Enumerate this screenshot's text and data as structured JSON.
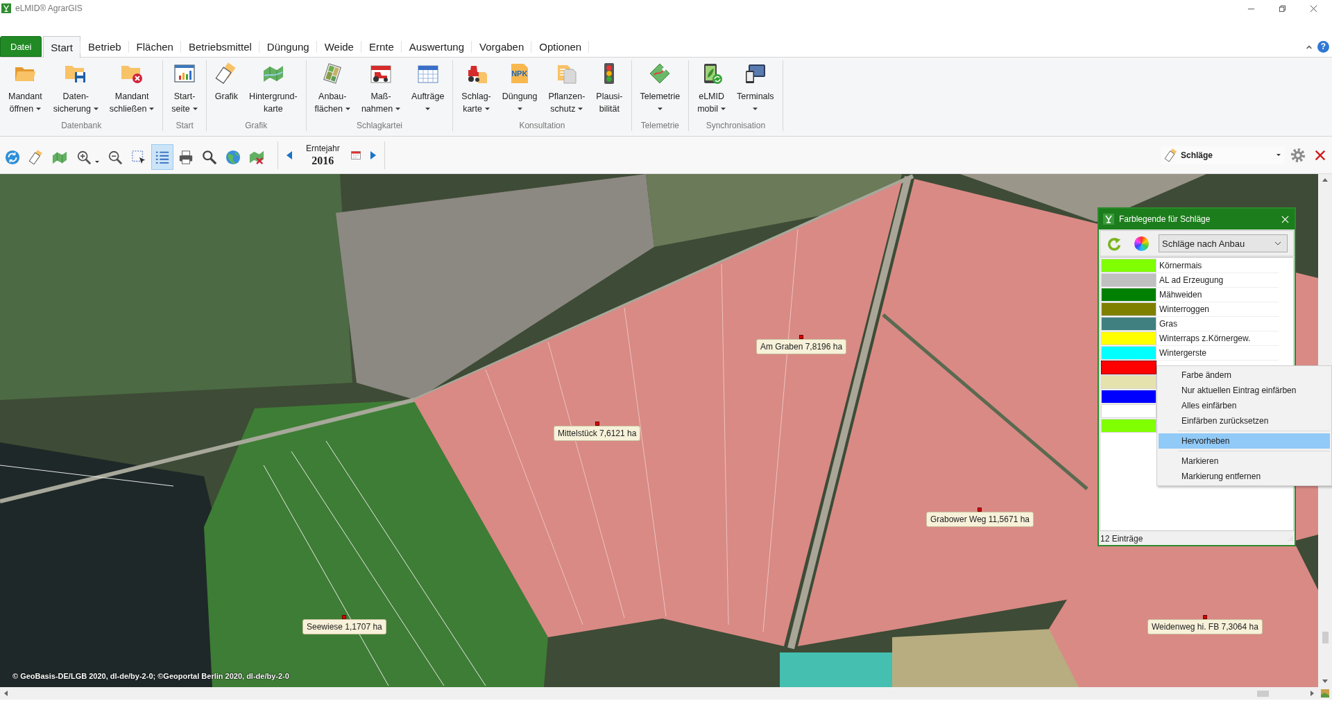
{
  "window": {
    "title": "eLMID® AgrarGIS"
  },
  "tabs": [
    {
      "label": "Datei",
      "kind": "file",
      "selected": false
    },
    {
      "label": "Start",
      "kind": "tab",
      "selected": true
    },
    {
      "label": "Betrieb",
      "kind": "tab",
      "selected": false
    },
    {
      "label": "Flächen",
      "kind": "tab",
      "selected": false
    },
    {
      "label": "Betriebsmittel",
      "kind": "tab",
      "selected": false
    },
    {
      "label": "Düngung",
      "kind": "tab",
      "selected": false
    },
    {
      "label": "Weide",
      "kind": "tab",
      "selected": false
    },
    {
      "label": "Ernte",
      "kind": "tab",
      "selected": false
    },
    {
      "label": "Auswertung",
      "kind": "tab",
      "selected": false
    },
    {
      "label": "Vorgaben",
      "kind": "tab",
      "selected": false
    },
    {
      "label": "Optionen",
      "kind": "tab",
      "selected": false
    }
  ],
  "ribbon": {
    "help": "?",
    "groups": [
      {
        "label": "Datenbank",
        "buttons": [
          {
            "lines": [
              "Mandant",
              "öffnen"
            ],
            "dropdown": true
          },
          {
            "lines": [
              "Daten-",
              "sicherung"
            ],
            "dropdown": true
          },
          {
            "lines": [
              "Mandant",
              "schließen"
            ],
            "dropdown": true
          }
        ]
      },
      {
        "label": "Start",
        "buttons": [
          {
            "lines": [
              "Start-",
              "seite"
            ],
            "dropdown": true
          }
        ]
      },
      {
        "label": "Grafik",
        "buttons": [
          {
            "lines": [
              "Grafik"
            ],
            "dropdown": false
          },
          {
            "lines": [
              "Hintergrund-",
              "karte"
            ],
            "dropdown": false
          }
        ]
      },
      {
        "label": "Schlagkartei",
        "buttons": [
          {
            "lines": [
              "Anbau-",
              "flächen"
            ],
            "dropdown": true
          },
          {
            "lines": [
              "Maß-",
              "nahmen"
            ],
            "dropdown": true
          },
          {
            "lines": [
              "Aufträge"
            ],
            "dropdown": true
          }
        ]
      },
      {
        "label": "Konsultation",
        "buttons": [
          {
            "lines": [
              "Schlag-",
              "karte"
            ],
            "dropdown": true
          },
          {
            "lines": [
              "Düngung"
            ],
            "dropdown": true,
            "icon_text": "NPK"
          },
          {
            "lines": [
              "Pflanzen-",
              "schutz"
            ],
            "dropdown": true
          },
          {
            "lines": [
              "Plausi-",
              "bilität"
            ],
            "dropdown": false
          }
        ]
      },
      {
        "label": "Telemetrie",
        "buttons": [
          {
            "lines": [
              "Telemetrie"
            ],
            "dropdown": true
          }
        ]
      },
      {
        "label": "Synchronisation",
        "buttons": [
          {
            "lines": [
              "eLMID",
              "mobil"
            ],
            "dropdown": true
          },
          {
            "lines": [
              "Terminals"
            ],
            "dropdown": true
          }
        ]
      }
    ]
  },
  "toolbar": {
    "tools": [
      {
        "selected": false,
        "dropdown": false
      },
      {
        "selected": false,
        "dropdown": false
      },
      {
        "selected": false,
        "dropdown": false
      },
      {
        "selected": false,
        "dropdown": true
      },
      {
        "selected": false,
        "dropdown": false
      },
      {
        "selected": false,
        "dropdown": false
      },
      {
        "selected": true,
        "dropdown": false
      },
      {
        "selected": false,
        "dropdown": false
      },
      {
        "selected": false,
        "dropdown": false
      },
      {
        "selected": false,
        "dropdown": false
      },
      {
        "selected": false,
        "dropdown": false
      }
    ],
    "year_label": "Erntejahr",
    "year": "2016",
    "layer": "Schläge"
  },
  "map": {
    "fields": [
      {
        "label": "Am Graben 7,8196 ha"
      },
      {
        "label": "Mittelstück 7,6121 ha"
      },
      {
        "label": "Grabower Weg 11,5671 ha"
      },
      {
        "label": "Seewiese 1,1707 ha"
      },
      {
        "label": "Weidenweg hi. FB 7,3064 ha"
      }
    ],
    "attribution": "© GeoBasis-DE/LGB 2020, dl-de/by-2-0; ©Geoportal Berlin 2020, dl-de/by-2-0"
  },
  "legend": {
    "title": "Farblegende für Schläge",
    "mode": "Schläge nach Anbau",
    "entries": [
      {
        "label": "Körnermais",
        "color": "#80ff00",
        "selected": false
      },
      {
        "label": "AL ad Erzeugung",
        "color": "#c0c0c0",
        "selected": false
      },
      {
        "label": "Mähweiden",
        "color": "#008000",
        "selected": false
      },
      {
        "label": "Winterroggen",
        "color": "#808000",
        "selected": false
      },
      {
        "label": "Gras",
        "color": "#408080",
        "selected": false
      },
      {
        "label": "Winterraps z.Körnergew.",
        "color": "#ffff00",
        "selected": false
      },
      {
        "label": "Wintergerste",
        "color": "#00ffff",
        "selected": false
      },
      {
        "color": "#ff0000",
        "selected": true
      },
      {
        "color": "#e6e2ad",
        "selected": false
      },
      {
        "color": "#0000ff",
        "selected": false
      },
      {
        "color": "#ffffff",
        "selected": false
      },
      {
        "color": "#80ff00",
        "selected": false
      }
    ],
    "count": "12 Einträge"
  },
  "context_menu": {
    "sections": [
      {
        "items": [
          {
            "label": "Farbe ändern",
            "selected": false
          },
          {
            "label": "Nur aktuellen Eintrag einfärben",
            "selected": false
          },
          {
            "label": "Alles einfärben",
            "selected": false
          },
          {
            "label": "Einfärben zurücksetzen",
            "selected": false
          }
        ]
      },
      {
        "items": [
          {
            "label": "Hervorheben",
            "selected": true
          }
        ]
      },
      {
        "items": [
          {
            "label": "Markieren",
            "selected": false
          },
          {
            "label": "Markierung entfernen",
            "selected": false
          }
        ]
      }
    ]
  }
}
